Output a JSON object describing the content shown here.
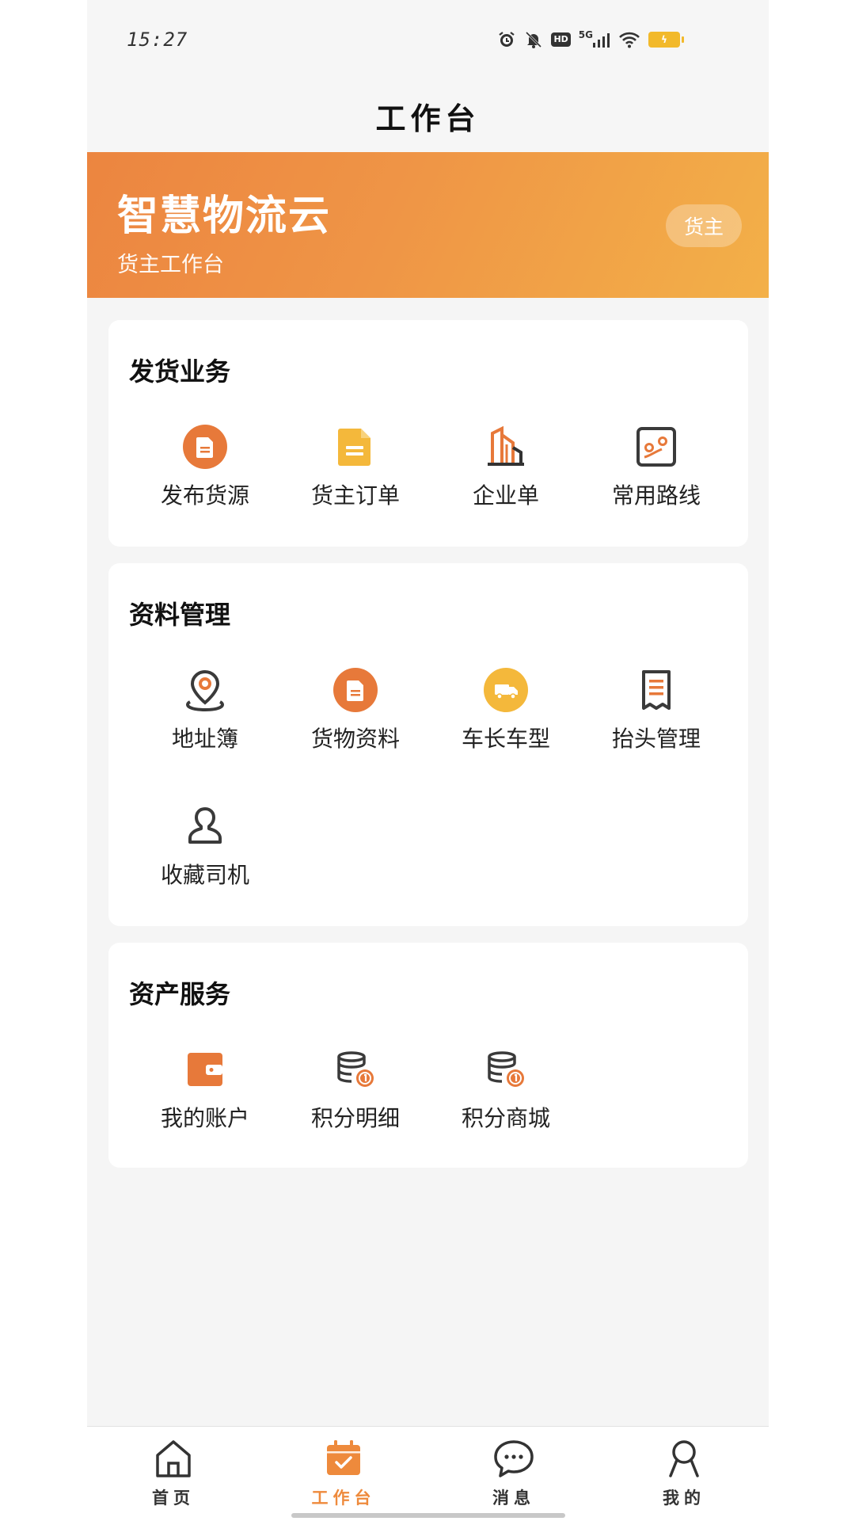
{
  "status_bar": {
    "time": "15:27",
    "icons": [
      "alarm-icon",
      "mute-icon",
      "hd-icon",
      "5g-signal-icon",
      "wifi-icon",
      "battery-icon"
    ],
    "hd_label": "HD",
    "network_label": "5G"
  },
  "header": {
    "title": "工作台"
  },
  "banner": {
    "title": "智慧物流云",
    "subtitle": "货主工作台",
    "role_badge": "货主",
    "gradient": [
      "#ec8540",
      "#f3b048"
    ]
  },
  "sections": [
    {
      "title": "发货业务",
      "items": [
        {
          "label": "发布货源",
          "icon": "publish-cargo-icon"
        },
        {
          "label": "货主订单",
          "icon": "order-document-icon"
        },
        {
          "label": "企业单",
          "icon": "building-icon"
        },
        {
          "label": "常用路线",
          "icon": "route-map-icon"
        }
      ]
    },
    {
      "title": "资料管理",
      "items": [
        {
          "label": "地址簿",
          "icon": "location-pin-icon"
        },
        {
          "label": "货物资料",
          "icon": "cargo-info-icon"
        },
        {
          "label": "车长车型",
          "icon": "truck-icon"
        },
        {
          "label": "抬头管理",
          "icon": "receipt-icon"
        },
        {
          "label": "收藏司机",
          "icon": "driver-user-icon"
        }
      ]
    },
    {
      "title": "资产服务",
      "items": [
        {
          "label": "我的账户",
          "icon": "wallet-icon"
        },
        {
          "label": "积分明细",
          "icon": "points-coins-icon"
        },
        {
          "label": "积分商城",
          "icon": "points-mall-icon"
        }
      ]
    }
  ],
  "bottom_nav": [
    {
      "label": "首页",
      "icon": "home-icon",
      "active": false
    },
    {
      "label": "工作台",
      "icon": "workbench-calendar-icon",
      "active": true
    },
    {
      "label": "消息",
      "icon": "message-bubble-icon",
      "active": false
    },
    {
      "label": "我的",
      "icon": "profile-icon",
      "active": false
    }
  ],
  "colors": {
    "accent": "#ee8a3c",
    "accent_dark": "#e7793a",
    "yellow": "#f4b83b",
    "icon_dark": "#3a3a3a",
    "background": "#f5f5f5"
  }
}
